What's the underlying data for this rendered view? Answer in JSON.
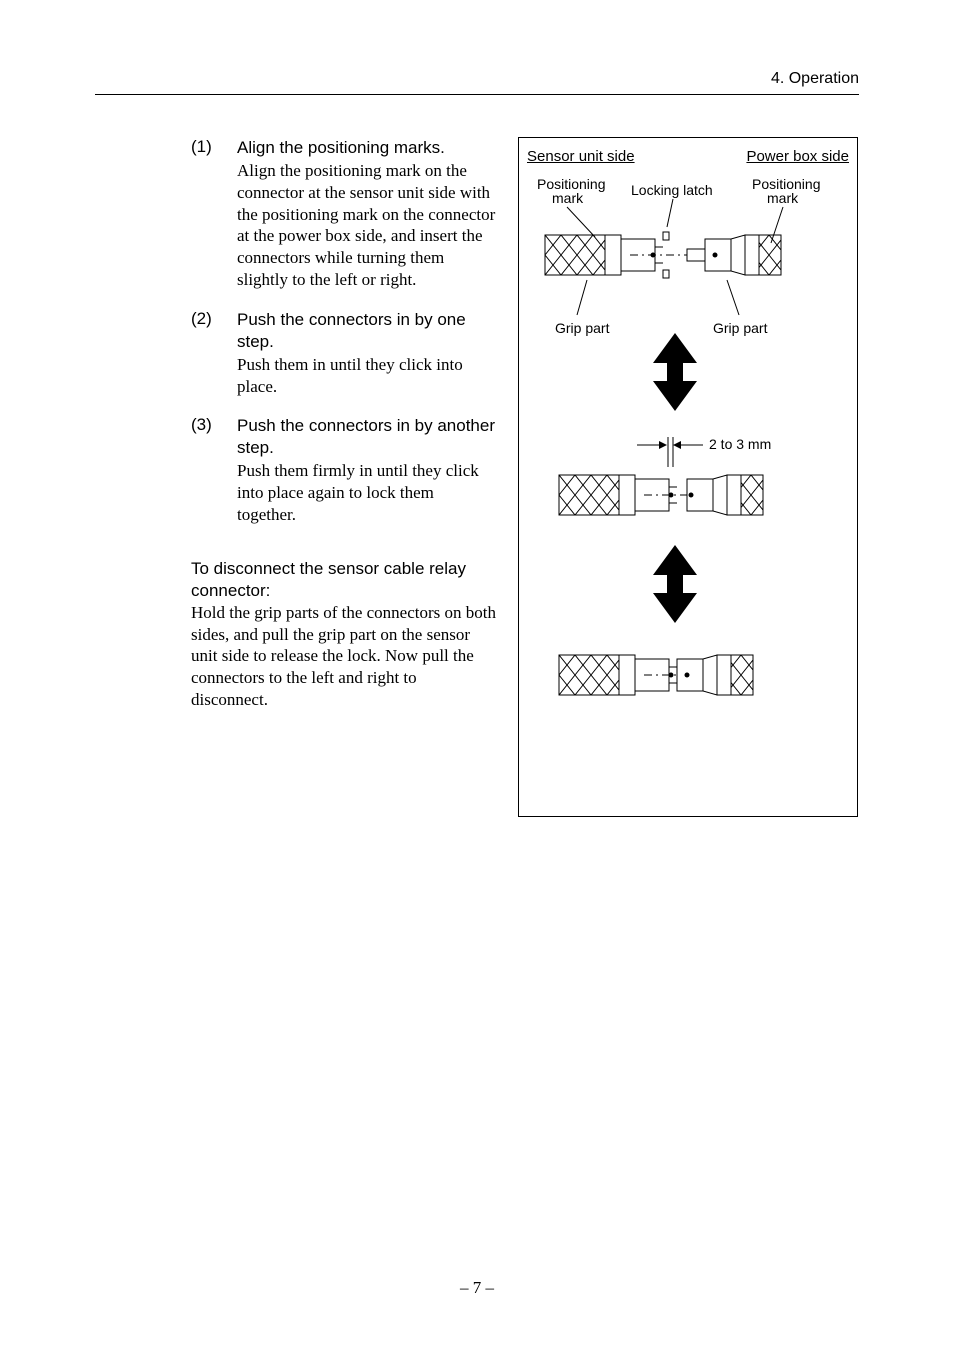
{
  "header": "4. Operation",
  "steps": [
    {
      "num": "(1)",
      "title": "Align the positioning marks.",
      "desc": "Align the positioning mark on the connector at the sensor unit side with the positioning mark on the connector at the power box side, and insert the connectors while turning them slightly to the left or right."
    },
    {
      "num": "(2)",
      "title": "Push the connectors in by one step.",
      "desc": "Push them in until they click into place."
    },
    {
      "num": "(3)",
      "title": "Push the connectors in by another step.",
      "desc": "Push them firmly in until they click into place again to lock them together."
    }
  ],
  "disconnect": {
    "title": "To disconnect the sensor cable relay con­nector:",
    "body": "Hold the grip parts of the connectors on both sides, and pull the grip part on the sensor unit side to release the lock. Now pull the connectors to the left and right to disconnect."
  },
  "figure": {
    "left_title": "Sensor unit side",
    "right_title": "Power box side",
    "pos_mark": "Positioning\nmark",
    "lock_latch": "Locking latch",
    "grip": "Grip part",
    "gap": "2 to 3 mm"
  },
  "page_number": "– 7 –"
}
